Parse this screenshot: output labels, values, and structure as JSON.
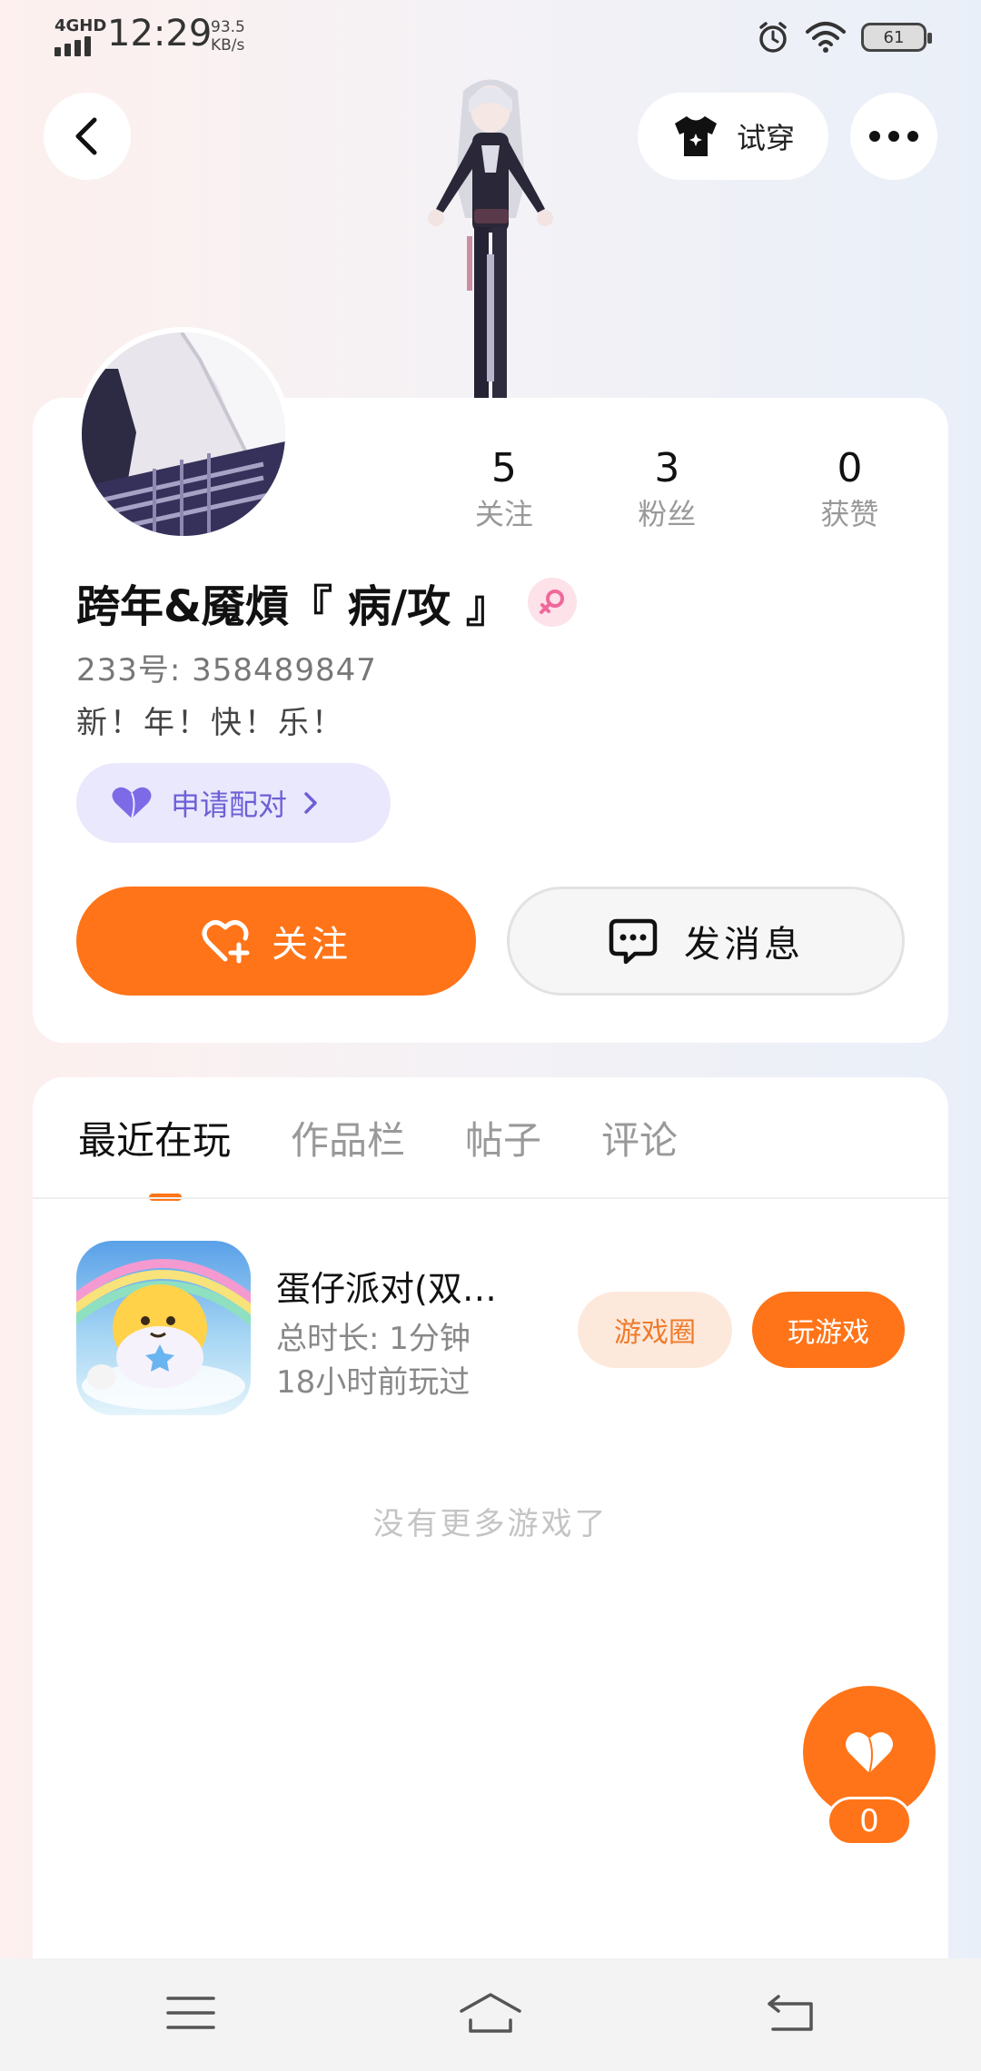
{
  "status_bar": {
    "network": "4GHD",
    "time": "12:29",
    "speed_value": "93.5",
    "speed_unit": "KB/s",
    "battery": "61"
  },
  "header": {
    "back_icon": "chevron-left-icon",
    "tryon_label": "试穿",
    "more_icon": "more-dots-icon"
  },
  "profile": {
    "stats": [
      {
        "value": "5",
        "label": "关注"
      },
      {
        "value": "3",
        "label": "粉丝"
      },
      {
        "value": "0",
        "label": "获赞"
      }
    ],
    "username": "跨年&魇熕『 病/攻 』",
    "gender_icon": "female-icon",
    "uid": "233号: 358489847",
    "bio": "新！年！快！乐！",
    "pair_label": "申请配对",
    "follow_label": "关注",
    "message_label": "发消息"
  },
  "tabs": [
    "最近在玩",
    "作品栏",
    "帖子",
    "评论"
  ],
  "recent_game": {
    "title": "蛋仔派对(双…",
    "total_time": "总时长:  1分钟",
    "last_played": "18小时前玩过",
    "circle_label": "游戏圈",
    "play_label": "玩游戏"
  },
  "empty_note": "没有更多游戏了",
  "like": {
    "count": "0"
  },
  "colors": {
    "accent": "#ff7418",
    "pair_bg": "#eae8fd",
    "pair_text": "#6d60d6"
  }
}
